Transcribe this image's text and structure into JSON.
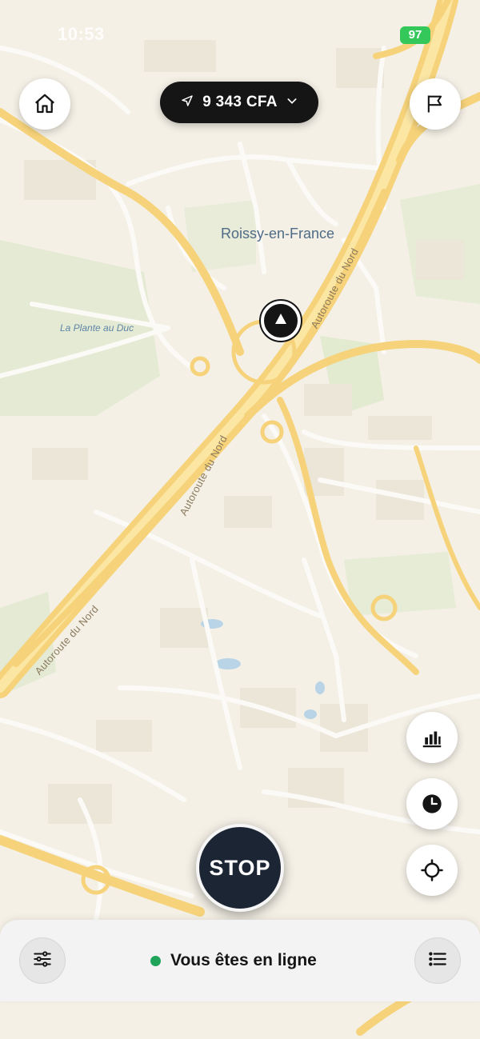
{
  "status_bar": {
    "time": "10:53",
    "battery": "97"
  },
  "earnings": {
    "amount": "9 343 CFA",
    "icon": "navigation-arrow-icon",
    "dropdown_icon": "chevron-down-icon"
  },
  "map": {
    "city_label": "Roissy-en-France",
    "area_label": "La Plante au Duc",
    "road_labels": [
      "Autoroute du Nord",
      "Autoroute du Nord",
      "Autoroute du Nord"
    ]
  },
  "buttons": {
    "home_icon": "home-icon",
    "flag_icon": "flag-icon",
    "stats_icon": "bar-chart-icon",
    "history_icon": "clock-icon",
    "locate_icon": "crosshair-icon",
    "stop_label": "STOP"
  },
  "bottom_bar": {
    "status_text": "Vous êtes en ligne",
    "settings_icon": "sliders-icon",
    "menu_icon": "list-icon"
  },
  "colors": {
    "online": "#1fa45a",
    "stop_button": "#1c2534",
    "pill": "#151515",
    "road": "#f6d37a",
    "map_bg": "#f4f0e6"
  }
}
